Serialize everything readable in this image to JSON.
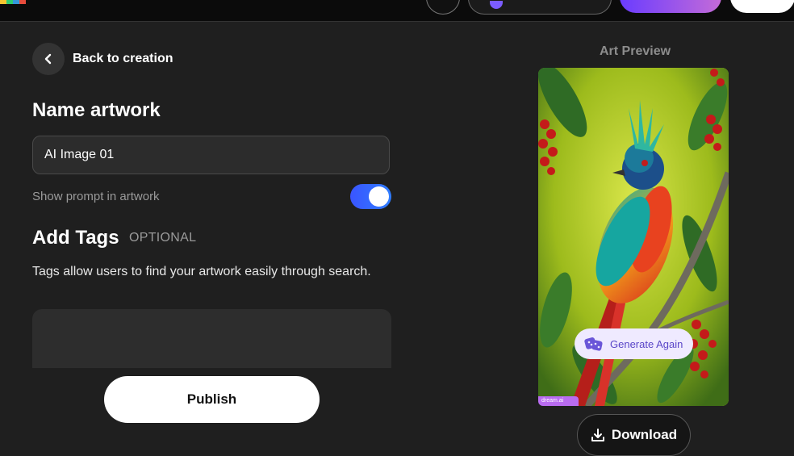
{
  "header": {
    "logo_icon": "app-logo-icon",
    "accent_gradient": [
      "#6a3cff",
      "#c46bd8"
    ]
  },
  "left": {
    "back_label": "Back to creation",
    "back_icon": "chevron-left-icon",
    "name_heading": "Name artwork",
    "name_value": "AI Image 01",
    "toggle_label": "Show prompt in artwork",
    "toggle_on": true,
    "tags_heading": "Add Tags",
    "tags_optional": "OPTIONAL",
    "tags_help": "Tags allow users to find your artwork easily through search.",
    "publish_label": "Publish"
  },
  "preview": {
    "title": "Art Preview",
    "generate_again_label": "Generate Again",
    "generate_icon": "dice-icon",
    "watermark": "dream.ai",
    "download_label": "Download",
    "download_icon": "download-icon"
  },
  "colors": {
    "background": "#1f1f1f",
    "toggle": "#3a55ff",
    "generate_text": "#5a46c8"
  }
}
